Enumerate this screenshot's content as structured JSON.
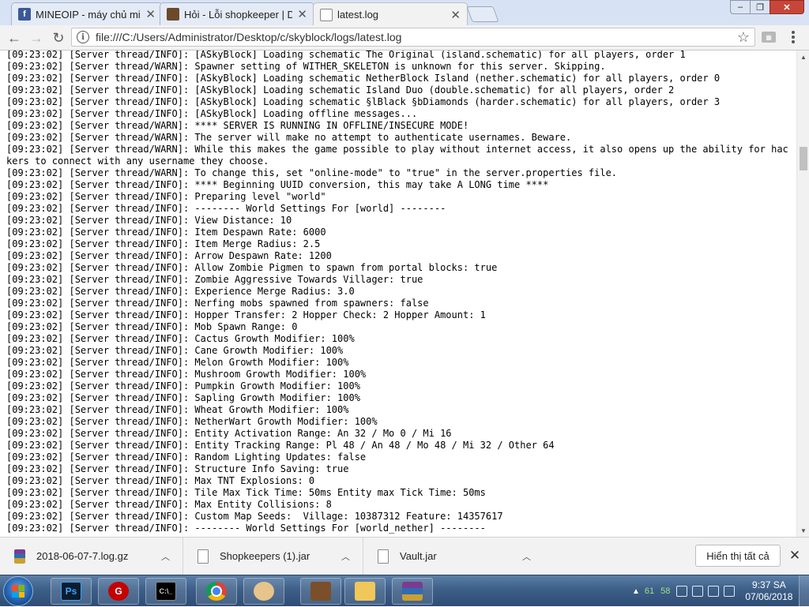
{
  "tabs": [
    {
      "title": "MINEOIP - máy chủ mine",
      "icon": "facebook-icon"
    },
    {
      "title": "Hỏi - Lỗi shopkeeper | Di",
      "icon": "minecraft-forum-icon"
    },
    {
      "title": "latest.log",
      "icon": "document-icon",
      "active": true
    }
  ],
  "window_controls": {
    "minimize": "–",
    "maximize": "❐",
    "close": "✕"
  },
  "address_bar": {
    "url": "file:///C:/Users/Administrator/Desktop/c/skyblock/logs/latest.log"
  },
  "log_lines": [
    "[09:23:02] [Server thread/INFO]: [ASkyBlock] Loading schematic The Original (island.schematic) for all players, order 1",
    "[09:23:02] [Server thread/WARN]: Spawner setting of WITHER_SKELETON is unknown for this server. Skipping.",
    "[09:23:02] [Server thread/INFO]: [ASkyBlock] Loading schematic NetherBlock Island (nether.schematic) for all players, order 0",
    "[09:23:02] [Server thread/INFO]: [ASkyBlock] Loading schematic Island Duo (double.schematic) for all players, order 2",
    "[09:23:02] [Server thread/INFO]: [ASkyBlock] Loading schematic §lBlack §bDiamonds (harder.schematic) for all players, order 3",
    "[09:23:02] [Server thread/INFO]: [ASkyBlock] Loading offline messages...",
    "[09:23:02] [Server thread/WARN]: **** SERVER IS RUNNING IN OFFLINE/INSECURE MODE!",
    "[09:23:02] [Server thread/WARN]: The server will make no attempt to authenticate usernames. Beware.",
    "[09:23:02] [Server thread/WARN]: While this makes the game possible to play without internet access, it also opens up the ability for hackers to connect with any username they choose.",
    "[09:23:02] [Server thread/WARN]: To change this, set \"online-mode\" to \"true\" in the server.properties file.",
    "[09:23:02] [Server thread/INFO]: **** Beginning UUID conversion, this may take A LONG time ****",
    "[09:23:02] [Server thread/INFO]: Preparing level \"world\"",
    "[09:23:02] [Server thread/INFO]: -------- World Settings For [world] --------",
    "[09:23:02] [Server thread/INFO]: View Distance: 10",
    "[09:23:02] [Server thread/INFO]: Item Despawn Rate: 6000",
    "[09:23:02] [Server thread/INFO]: Item Merge Radius: 2.5",
    "[09:23:02] [Server thread/INFO]: Arrow Despawn Rate: 1200",
    "[09:23:02] [Server thread/INFO]: Allow Zombie Pigmen to spawn from portal blocks: true",
    "[09:23:02] [Server thread/INFO]: Zombie Aggressive Towards Villager: true",
    "[09:23:02] [Server thread/INFO]: Experience Merge Radius: 3.0",
    "[09:23:02] [Server thread/INFO]: Nerfing mobs spawned from spawners: false",
    "[09:23:02] [Server thread/INFO]: Hopper Transfer: 2 Hopper Check: 2 Hopper Amount: 1",
    "[09:23:02] [Server thread/INFO]: Mob Spawn Range: 0",
    "[09:23:02] [Server thread/INFO]: Cactus Growth Modifier: 100%",
    "[09:23:02] [Server thread/INFO]: Cane Growth Modifier: 100%",
    "[09:23:02] [Server thread/INFO]: Melon Growth Modifier: 100%",
    "[09:23:02] [Server thread/INFO]: Mushroom Growth Modifier: 100%",
    "[09:23:02] [Server thread/INFO]: Pumpkin Growth Modifier: 100%",
    "[09:23:02] [Server thread/INFO]: Sapling Growth Modifier: 100%",
    "[09:23:02] [Server thread/INFO]: Wheat Growth Modifier: 100%",
    "[09:23:02] [Server thread/INFO]: NetherWart Growth Modifier: 100%",
    "[09:23:02] [Server thread/INFO]: Entity Activation Range: An 32 / Mo 0 / Mi 16",
    "[09:23:02] [Server thread/INFO]: Entity Tracking Range: Pl 48 / An 48 / Mo 48 / Mi 32 / Other 64",
    "[09:23:02] [Server thread/INFO]: Random Lighting Updates: false",
    "[09:23:02] [Server thread/INFO]: Structure Info Saving: true",
    "[09:23:02] [Server thread/INFO]: Max TNT Explosions: 0",
    "[09:23:02] [Server thread/INFO]: Tile Max Tick Time: 50ms Entity max Tick Time: 50ms",
    "[09:23:02] [Server thread/INFO]: Max Entity Collisions: 8",
    "[09:23:02] [Server thread/INFO]: Custom Map Seeds:  Village: 10387312 Feature: 14357617",
    "[09:23:02] [Server thread/INFO]: -------- World Settings For [world_nether] --------"
  ],
  "downloads": [
    {
      "name": "2018-06-07-7.log.gz",
      "icon": "winrar-archive-icon"
    },
    {
      "name": "Shopkeepers (1).jar",
      "icon": "file-icon"
    },
    {
      "name": "Vault.jar",
      "icon": "file-icon"
    }
  ],
  "downloads_show_all": "Hiển thị tất cả",
  "taskbar": {
    "apps": [
      "photoshop-icon",
      "garena-icon",
      "cmd-icon",
      "chrome-icon",
      "paint-icon",
      "minecraft-icon",
      "explorer-icon",
      "winrar-icon"
    ],
    "tray_values": [
      "61",
      "58"
    ],
    "time": "9:37 SA",
    "date": "07/06/2018"
  }
}
